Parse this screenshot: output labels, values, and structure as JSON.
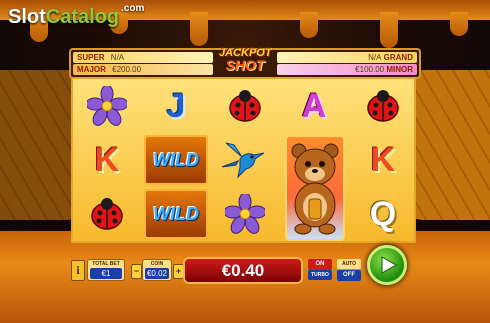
{
  "watermark": {
    "slot": "Slot",
    "catalog": "Catalog",
    "com": ".com"
  },
  "jackpots": {
    "title_line1": "JACKPOT",
    "title_line2": "SHOT",
    "super": {
      "label": "SUPER",
      "value": "N/A"
    },
    "major": {
      "label": "MAJOR",
      "value": "€200.00"
    },
    "grand": {
      "label": "GRAND",
      "value": "N/A"
    },
    "minor": {
      "label": "MINOR",
      "value": "€100.00"
    }
  },
  "reels": [
    [
      {
        "symbol": "flower-icon"
      },
      {
        "symbol": "K",
        "color": "#f24a1a"
      },
      {
        "symbol": "ladybug-icon"
      }
    ],
    [
      {
        "symbol": "J",
        "color": "#1e5fd1"
      },
      {
        "symbol": "WILD"
      },
      {
        "symbol": "WILD"
      }
    ],
    [
      {
        "symbol": "ladybug-icon"
      },
      {
        "symbol": "hummingbird-icon"
      },
      {
        "symbol": "flower-icon"
      }
    ],
    [
      {
        "symbol": "A",
        "color": "#d03bd0"
      },
      {
        "symbol": "bear-icon"
      },
      {
        "symbol": "bear-icon"
      }
    ],
    [
      {
        "symbol": "ladybug-icon"
      },
      {
        "symbol": "K",
        "color": "#f24a1a"
      },
      {
        "symbol": "Q",
        "color": "#ffffff"
      }
    ]
  ],
  "reel_letters": {
    "j": "J",
    "k": "K",
    "a": "A",
    "q": "Q",
    "wild": "WILD"
  },
  "controls": {
    "info_label": "i",
    "total_bet_label": "TOTAL BET",
    "total_bet_value": "€1",
    "coin_label": "COIN",
    "coin_value": "€0.02",
    "minus_label": "−",
    "plus_label": "+",
    "win_amount": "€0.40",
    "turbo_state": "ON",
    "turbo_label": "TURBO",
    "auto_label": "AUTO",
    "auto_state": "OFF"
  },
  "colors": {
    "accent_gold": "#f2b84a",
    "spin_green": "#1e8a0a",
    "win_red": "#d01a1a"
  }
}
